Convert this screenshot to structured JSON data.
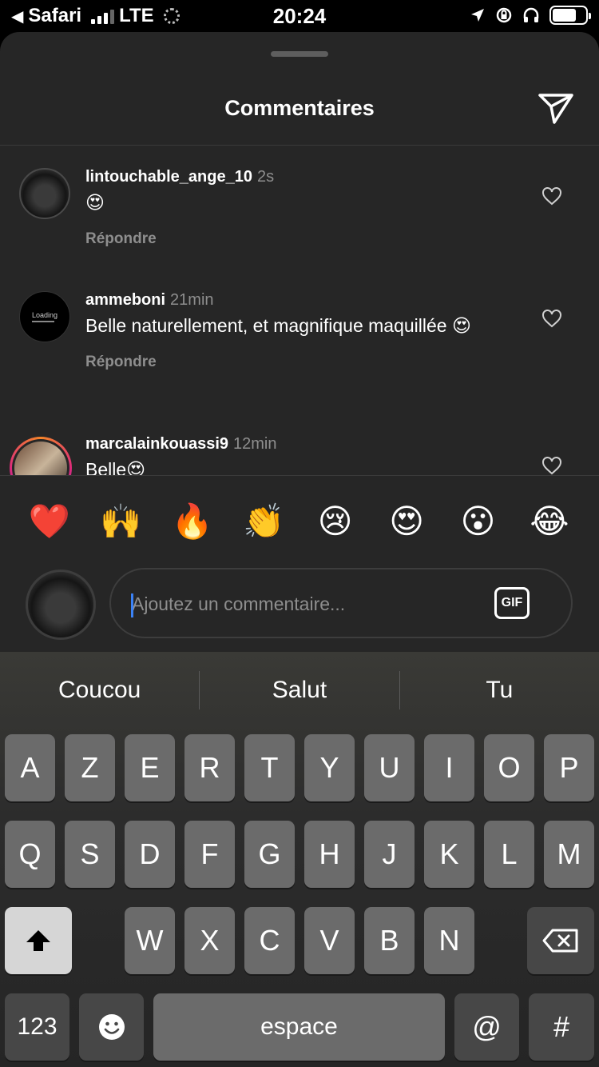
{
  "status_bar": {
    "back_app": "Safari",
    "network": "LTE",
    "time": "20:24"
  },
  "sheet": {
    "title": "Commentaires"
  },
  "comments": [
    {
      "username": "lintouchable_ange_10",
      "time": "2s",
      "text": "😍",
      "reply_label": "Répondre"
    },
    {
      "username": "ammeboni",
      "time": "21min",
      "text": "Belle naturellement, et magnifique maquillée 😍",
      "reply_label": "Répondre",
      "avatar_text": "Loading"
    },
    {
      "username": "marcalainkouassi9",
      "time": "12min",
      "text": "Belle😍"
    }
  ],
  "emoji_reactions": [
    "❤️",
    "🙌",
    "🔥",
    "👏",
    "😢",
    "😍",
    "😮",
    "😂"
  ],
  "composer": {
    "placeholder": "Ajoutez un commentaire...",
    "gif_label": "GIF"
  },
  "keyboard": {
    "suggestions": [
      "Coucou",
      "Salut",
      "Tu"
    ],
    "row1": [
      "A",
      "Z",
      "E",
      "R",
      "T",
      "Y",
      "U",
      "I",
      "O",
      "P"
    ],
    "row2": [
      "Q",
      "S",
      "D",
      "F",
      "G",
      "H",
      "J",
      "K",
      "L",
      "M"
    ],
    "row3": [
      "W",
      "X",
      "C",
      "V",
      "B",
      "N"
    ],
    "numbers_label": "123",
    "space_label": "espace",
    "at_label": "@",
    "hash_label": "#"
  }
}
